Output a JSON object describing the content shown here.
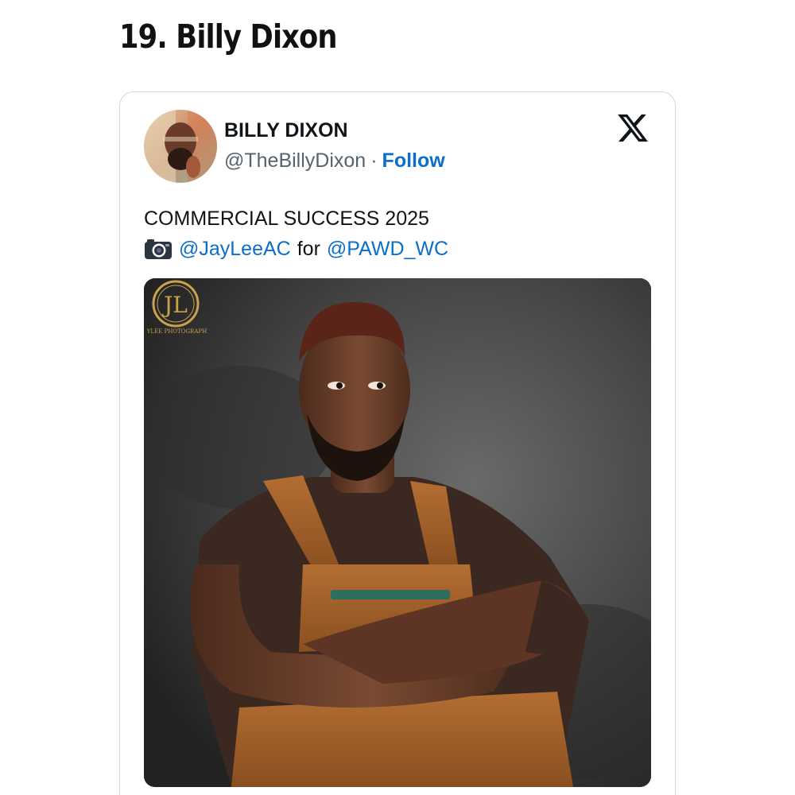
{
  "article": {
    "heading": "19. Billy Dixon"
  },
  "tweet": {
    "display_name": "BILLY DIXON",
    "handle": "@TheBillyDixon",
    "separator": "·",
    "follow_label": "Follow",
    "text_line1": "COMMERCIAL SUCCESS 2025",
    "mention_photographer": "@JayLeeAC",
    "for_word": "for",
    "mention_client": "@PAWD_WC",
    "photo_watermark": "JL",
    "photo_watermark_caption": "JAYLEE PHOTOGRAPHY"
  },
  "icons": {
    "brand": "x-logo-icon",
    "camera": "camera-icon"
  },
  "colors": {
    "link": "#0b6fc9",
    "border": "#cfd9de",
    "text": "#0f1419",
    "muted": "#536471"
  }
}
